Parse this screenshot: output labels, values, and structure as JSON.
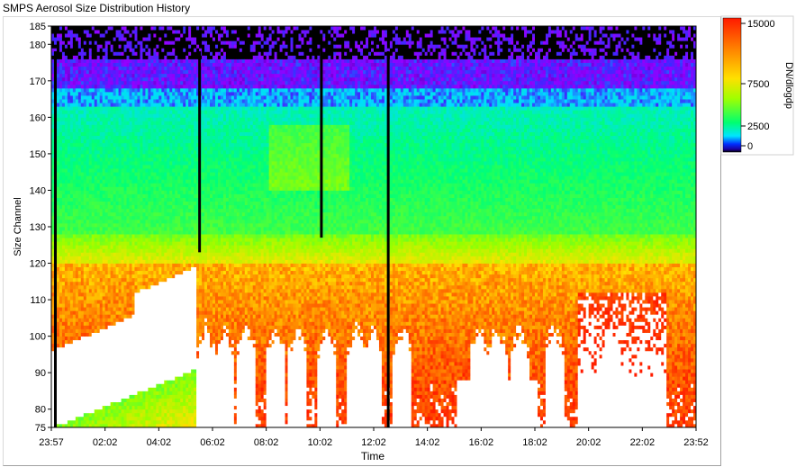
{
  "window": {
    "title": "SMPS Aerosol Size Distribution History"
  },
  "chart_data": {
    "type": "heatmap",
    "title": "",
    "xlabel": "Time",
    "ylabel": "Size Channel",
    "x_tick_labels": [
      "23:57",
      "02:02",
      "04:02",
      "06:02",
      "08:02",
      "10:02",
      "12:02",
      "14:02",
      "16:02",
      "18:02",
      "20:02",
      "22:02",
      "23:52"
    ],
    "y_tick_labels": [
      "75",
      "80",
      "90",
      "100",
      "110",
      "120",
      "130",
      "140",
      "150",
      "160",
      "170",
      "180",
      "185"
    ],
    "y_ticks": [
      75,
      80,
      90,
      100,
      110,
      120,
      130,
      140,
      150,
      160,
      170,
      180,
      185
    ],
    "ylim": [
      75,
      185
    ],
    "colorbar": {
      "label": "DN/dlogdp",
      "tick_labels": [
        "15000",
        "7500",
        "2500",
        "0"
      ],
      "ticks": [
        15000,
        7500,
        2500,
        0
      ],
      "range": [
        0,
        15000
      ]
    },
    "time_range_hours": [
      -0.05,
      23.87
    ],
    "missing_data_lines_hours": [
      0.1,
      5.45,
      9.97,
      12.45
    ],
    "saturation": "white above 15000",
    "notes_regions": [
      {
        "region": "channels 170-185",
        "level": "0-1000 (black/violet, sparse)"
      },
      {
        "region": "channels 130-165",
        "level": "2500-5000 (cyan/green)"
      },
      {
        "region": "channels 75-120",
        "level": "7500-15000+ (yellow/orange/red, white saturation)"
      }
    ]
  },
  "colors": {
    "background": "#ffffff",
    "axis": "#000000",
    "colormap": [
      "#000000",
      "#3a00ff",
      "#b400ff",
      "#00e5ff",
      "#00ff70",
      "#c8ff00",
      "#ffd000",
      "#ff8000",
      "#ff2000",
      "#ffffff"
    ]
  }
}
